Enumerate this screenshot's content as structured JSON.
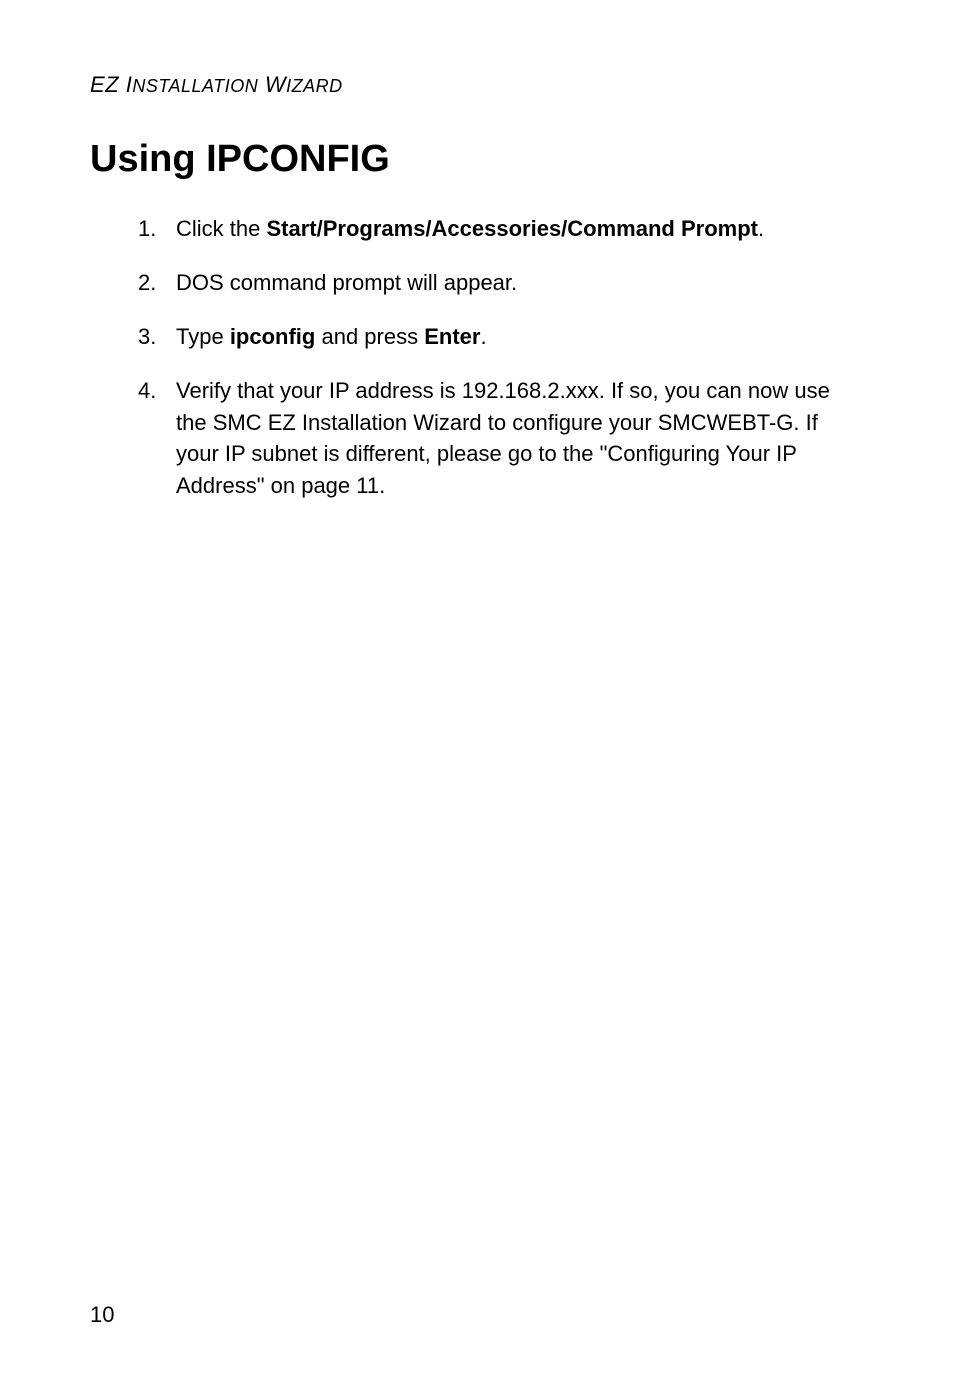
{
  "header": {
    "text": "EZ Installation Wizard"
  },
  "title": "Using IPCONFIG",
  "steps": [
    {
      "num": "1.",
      "prefix": "Click the ",
      "bold": "Start/Programs/Accessories/Command Prompt",
      "suffix": "."
    },
    {
      "num": "2.",
      "prefix": "DOS command prompt will appear.",
      "bold": "",
      "suffix": ""
    },
    {
      "num": "3.",
      "prefix": "Type ",
      "bold": "ipconfig",
      "mid": " and press ",
      "bold2": "Enter",
      "suffix": "."
    },
    {
      "num": "4.",
      "prefix": "Verify that your IP address is 192.168.2.xxx. If so, you can now use the SMC EZ Installation Wizard to configure your SMCWEBT-G. If your IP subnet is different, please go to the \"Configuring Your IP Address\" on page 11.",
      "bold": "",
      "suffix": ""
    }
  ],
  "pageNumber": "10"
}
